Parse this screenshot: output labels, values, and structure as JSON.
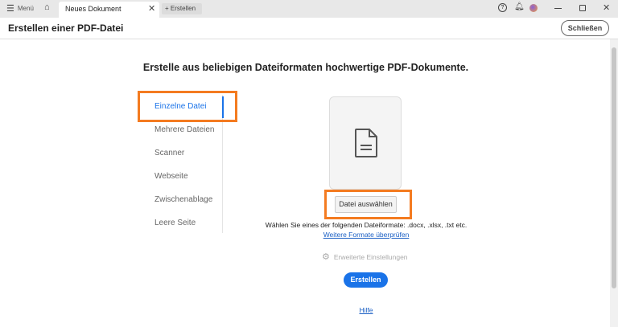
{
  "titlebar": {
    "menu": "Menü",
    "tab": "Neues Dokument",
    "new_tab": "Erstellen"
  },
  "header": {
    "title": "Erstellen einer PDF-Datei",
    "close": "Schließen"
  },
  "main": {
    "heading": "Erstelle aus beliebigen Dateiformaten hochwertige PDF-Dokumente.",
    "sidebar": [
      {
        "label": "Einzelne Datei"
      },
      {
        "label": "Mehrere Dateien"
      },
      {
        "label": "Scanner"
      },
      {
        "label": "Webseite"
      },
      {
        "label": "Zwischenablage"
      },
      {
        "label": "Leere Seite"
      }
    ],
    "choose_file": "Datei auswählen",
    "formats_text": "Wählen Sie eines der folgenden Dateiformate: .docx, .xlsx, .txt etc.",
    "formats_link": "Weitere Formate überprüfen",
    "advanced": "Erweiterte Einstellungen",
    "create": "Erstellen",
    "help": "Hilfe"
  },
  "colors": {
    "accent": "#1a73e8",
    "highlight": "#f47b20"
  }
}
